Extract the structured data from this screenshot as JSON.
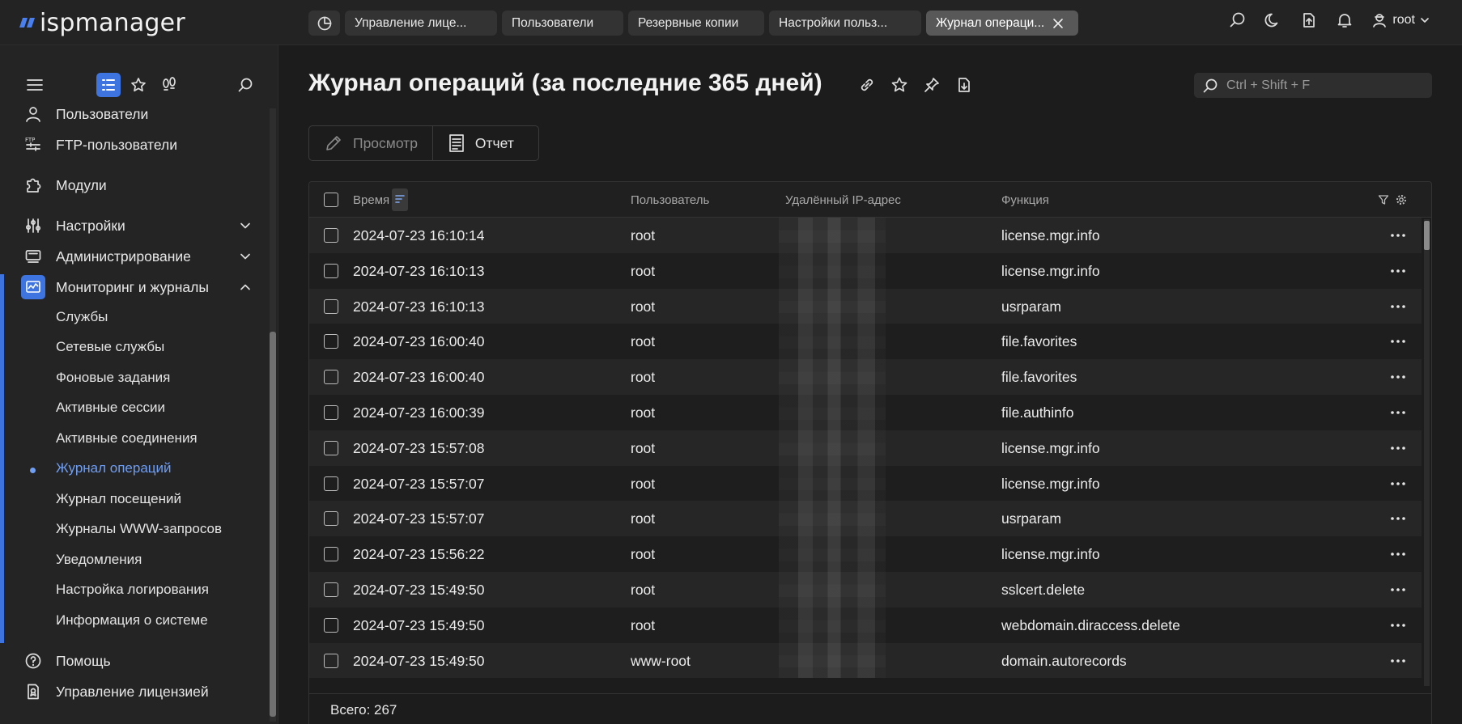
{
  "brand": {
    "name": "ispmanager"
  },
  "tabs": [
    {
      "label": ""
    },
    {
      "label": "Управление лице..."
    },
    {
      "label": "Пользователи"
    },
    {
      "label": "Резервные копии"
    },
    {
      "label": "Настройки польз..."
    },
    {
      "label": "Журнал операци..."
    }
  ],
  "user": {
    "name": "root"
  },
  "sidebar": {
    "items": [
      {
        "label": "Пользователи",
        "icon": "user-icon"
      },
      {
        "label": "FTP-пользователи",
        "icon": "ftp-icon"
      },
      {
        "label": "Модули",
        "icon": "puzzle-icon"
      },
      {
        "label": "Настройки",
        "icon": "sliders-icon"
      },
      {
        "label": "Администрирование",
        "icon": "server-icon"
      },
      {
        "label": "Мониторинг и журналы",
        "icon": "monitor-chart-icon"
      },
      {
        "label": "Помощь",
        "icon": "help-icon"
      },
      {
        "label": "Управление лицензией",
        "icon": "license-icon"
      }
    ],
    "sub_items": [
      {
        "label": "Службы"
      },
      {
        "label": "Сетевые службы"
      },
      {
        "label": "Фоновые задания"
      },
      {
        "label": "Активные сессии"
      },
      {
        "label": "Активные соединения"
      },
      {
        "label": "Журнал операций"
      },
      {
        "label": "Журнал посещений"
      },
      {
        "label": "Журналы WWW-запросов"
      },
      {
        "label": "Уведомления"
      },
      {
        "label": "Настройка логирования"
      },
      {
        "label": "Информация о системе"
      }
    ]
  },
  "page": {
    "title": "Журнал операций (за последние 365 дней)"
  },
  "search": {
    "placeholder": "Ctrl + Shift + F"
  },
  "toolbar": {
    "view_label": "Просмотр",
    "report_label": "Отчет"
  },
  "table": {
    "columns": [
      "Время",
      "Пользователь",
      "Удалённый IP-адрес",
      "Функция"
    ],
    "rows": [
      {
        "time": "2024-07-23 16:10:14",
        "user": "root",
        "func": "license.mgr.info"
      },
      {
        "time": "2024-07-23 16:10:13",
        "user": "root",
        "func": "license.mgr.info"
      },
      {
        "time": "2024-07-23 16:10:13",
        "user": "root",
        "func": "usrparam"
      },
      {
        "time": "2024-07-23 16:00:40",
        "user": "root",
        "func": "file.favorites"
      },
      {
        "time": "2024-07-23 16:00:40",
        "user": "root",
        "func": "file.favorites"
      },
      {
        "time": "2024-07-23 16:00:39",
        "user": "root",
        "func": "file.authinfo"
      },
      {
        "time": "2024-07-23 15:57:08",
        "user": "root",
        "func": "license.mgr.info"
      },
      {
        "time": "2024-07-23 15:57:07",
        "user": "root",
        "func": "license.mgr.info"
      },
      {
        "time": "2024-07-23 15:57:07",
        "user": "root",
        "func": "usrparam"
      },
      {
        "time": "2024-07-23 15:56:22",
        "user": "root",
        "func": "license.mgr.info"
      },
      {
        "time": "2024-07-23 15:49:50",
        "user": "root",
        "func": "sslcert.delete"
      },
      {
        "time": "2024-07-23 15:49:50",
        "user": "root",
        "func": "webdomain.diraccess.delete"
      },
      {
        "time": "2024-07-23 15:49:50",
        "user": "www-root",
        "func": "domain.autorecords"
      }
    ],
    "total_label": "Всего: 267"
  },
  "colors": {
    "accent": "#3d74e0",
    "active_link": "#6f9ef5",
    "background": "#1c1c1c"
  }
}
